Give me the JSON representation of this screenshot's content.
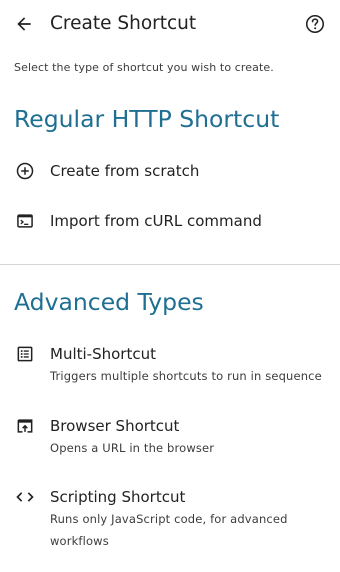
{
  "header": {
    "title": "Create Shortcut",
    "back_icon": "arrow-back-icon",
    "help_icon": "help-circle-icon"
  },
  "subtitle": "Select the type of shortcut you wish to create.",
  "sections": {
    "regular": {
      "heading": "Regular HTTP Shortcut",
      "items": [
        {
          "icon": "add-circle-icon",
          "label": "Create from scratch"
        },
        {
          "icon": "terminal-icon",
          "label": "Import from cURL command"
        }
      ]
    },
    "advanced": {
      "heading": "Advanced Types",
      "items": [
        {
          "icon": "list-icon",
          "label": "Multi-Shortcut",
          "description": "Triggers multiple shortcuts to run in sequence"
        },
        {
          "icon": "open-in-browser-icon",
          "label": "Browser Shortcut",
          "description": "Opens a URL in the browser"
        },
        {
          "icon": "code-icon",
          "label": "Scripting Shortcut",
          "description": "Runs only JavaScript code, for advanced workflows"
        }
      ]
    }
  },
  "colors": {
    "accent": "#1f6f93",
    "text": "#222222",
    "secondary_text": "#3c3c3c",
    "divider": "#d4d4d4",
    "background": "#ffffff"
  }
}
